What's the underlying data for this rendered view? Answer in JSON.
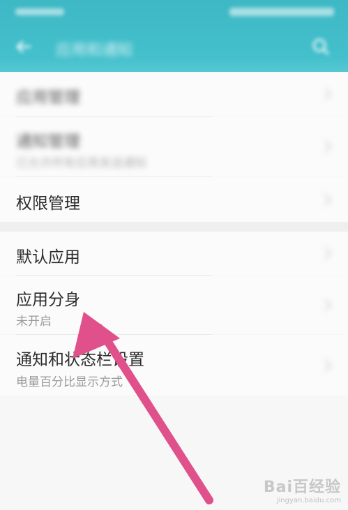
{
  "app_bar": {
    "title": "应用和通知",
    "back_icon": "arrow-left-icon",
    "search_icon": "search-icon",
    "color": "#44c0cc"
  },
  "items": [
    {
      "title": "应用管理",
      "subtitle": "",
      "blurred": true
    },
    {
      "title": "通知管理",
      "subtitle": "已允许所有应用发送通知",
      "blurred": true
    },
    {
      "title": "权限管理",
      "subtitle": "",
      "blurred": false
    },
    {
      "title": "默认应用",
      "subtitle": "",
      "blurred": false
    },
    {
      "title": "应用分身",
      "subtitle": "未开启",
      "blurred": false
    },
    {
      "title": "通知和状态栏设置",
      "subtitle": "电量百分比显示方式",
      "blurred": false
    }
  ],
  "annotation": {
    "type": "arrow",
    "color": "#e0508a",
    "points_to": "应用分身"
  },
  "watermark": {
    "logo": "Bai百经验",
    "url": "jingyan.baidu.com"
  }
}
